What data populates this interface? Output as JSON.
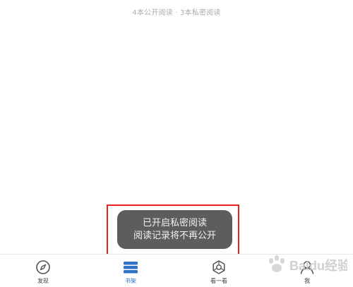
{
  "header": {
    "stats_text": "4本公开阅读 · 3本私密阅读"
  },
  "toast": {
    "line1": "已开启私密阅读",
    "line2": "阅读记录将不再公开"
  },
  "tabbar": {
    "tabs": [
      {
        "label": "发现",
        "icon": "compass-icon",
        "active": false
      },
      {
        "label": "书架",
        "icon": "bookshelf-icon",
        "active": true
      },
      {
        "label": "看一看",
        "icon": "look-icon",
        "active": false
      },
      {
        "label": "我",
        "icon": "profile-icon",
        "active": false
      }
    ]
  },
  "watermark": {
    "text": "Baidu经验"
  },
  "colors": {
    "accent": "#2e72c6",
    "highlight_border": "#e8231f",
    "toast_bg": "#5d5d5d"
  }
}
